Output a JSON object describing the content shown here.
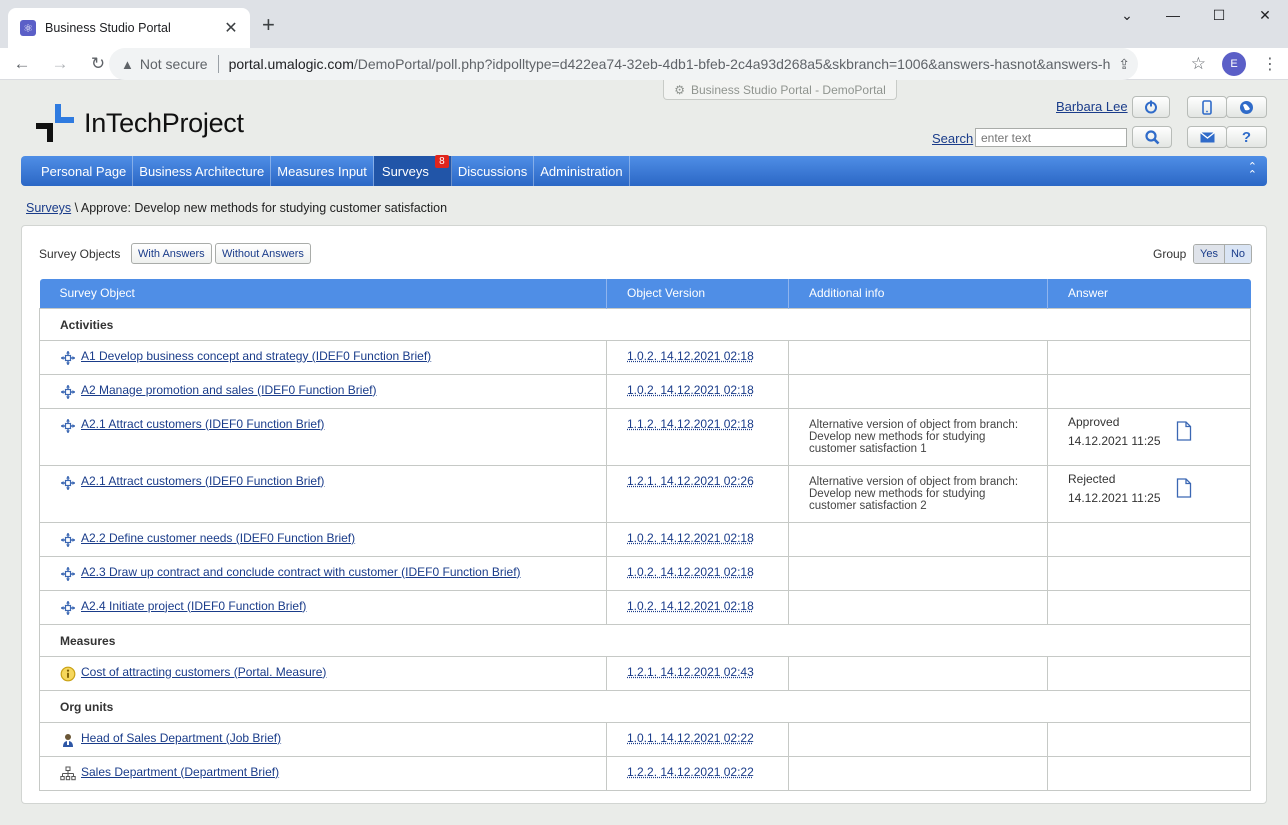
{
  "browser": {
    "tab_title": "Business Studio Portal",
    "security_label": "Not secure",
    "url_host": "portal.umalogic.com",
    "url_path": "/DemoPortal/poll.php?idpolltype=d422ea74-32eb-4db1-bfeb-2c4a93d268a5&skbranch=1006&answers-hasnot&answers-has",
    "profile_initial": "E"
  },
  "header": {
    "portal_tag": "Business Studio Portal - DemoPortal",
    "logo_text": "InTechProject",
    "user_name": "Barbara Lee",
    "search_label": "Search",
    "search_placeholder": "enter text"
  },
  "nav": {
    "items": [
      "Personal Page",
      "Business Architecture",
      "Measures Input",
      "Surveys",
      "Discussions",
      "Administration"
    ],
    "active": "Surveys",
    "surveys_badge": "8"
  },
  "breadcrumb": {
    "root": "Surveys",
    "sep": " \\ ",
    "current": "Approve: Develop new methods for studying customer satisfaction"
  },
  "filters": {
    "label": "Survey Objects",
    "with_answers": "With Answers",
    "without_answers": "Without Answers",
    "group_label": "Group",
    "group_yes": "Yes",
    "group_no": "No"
  },
  "table": {
    "columns": [
      "Survey Object",
      "Object Version",
      "Additional info",
      "Answer"
    ],
    "sections": [
      {
        "title": "Activities",
        "rows": [
          {
            "icon": "function-icon",
            "name": "A1 Develop business concept and strategy (IDEF0 Function Brief)",
            "version": "1.0.2. 14.12.2021 02:18",
            "info": "",
            "answer": "",
            "answer_date": ""
          },
          {
            "icon": "function-icon",
            "name": "A2 Manage promotion and sales (IDEF0 Function Brief)",
            "version": "1.0.2. 14.12.2021 02:18",
            "info": "",
            "answer": "",
            "answer_date": ""
          },
          {
            "icon": "function-icon",
            "name": "A2.1 Attract customers (IDEF0 Function Brief)",
            "version": "1.1.2. 14.12.2021 02:18",
            "info": "Alternative version of object from branch: Develop new methods for studying customer satisfaction 1",
            "answer": "Approved",
            "answer_date": "14.12.2021 11:25"
          },
          {
            "icon": "function-icon",
            "name": "A2.1 Attract customers (IDEF0 Function Brief)",
            "version": "1.2.1. 14.12.2021 02:26",
            "info": "Alternative version of object from branch: Develop new methods for studying customer satisfaction 2",
            "answer": "Rejected",
            "answer_date": "14.12.2021 11:25"
          },
          {
            "icon": "function-icon",
            "name": "A2.2 Define customer needs (IDEF0 Function Brief)",
            "version": "1.0.2. 14.12.2021 02:18",
            "info": "",
            "answer": "",
            "answer_date": ""
          },
          {
            "icon": "function-icon",
            "name": "A2.3 Draw up contract and conclude contract with customer (IDEF0 Function Brief)",
            "version": "1.0.2. 14.12.2021 02:18",
            "info": "",
            "answer": "",
            "answer_date": ""
          },
          {
            "icon": "function-icon",
            "name": "A2.4 Initiate project (IDEF0 Function Brief)",
            "version": "1.0.2. 14.12.2021 02:18",
            "info": "",
            "answer": "",
            "answer_date": ""
          }
        ]
      },
      {
        "title": "Measures",
        "rows": [
          {
            "icon": "measure-icon",
            "name": "Cost of attracting customers (Portal. Measure)",
            "version": "1.2.1. 14.12.2021 02:43",
            "info": "",
            "answer": "",
            "answer_date": ""
          }
        ]
      },
      {
        "title": "Org units",
        "rows": [
          {
            "icon": "person-icon",
            "name": "Head of Sales Department (Job Brief)",
            "version": "1.0.1. 14.12.2021 02:22",
            "info": "",
            "answer": "",
            "answer_date": ""
          },
          {
            "icon": "org-chart-icon",
            "name": "Sales Department (Department Brief)",
            "version": "1.2.2. 14.12.2021 02:22",
            "info": "",
            "answer": "",
            "answer_date": ""
          }
        ]
      }
    ]
  },
  "colors": {
    "nav_blue": "#4f8ee6",
    "nav_active": "#2155a8",
    "link": "#1a3c8a",
    "badge_red": "#e0251c"
  }
}
